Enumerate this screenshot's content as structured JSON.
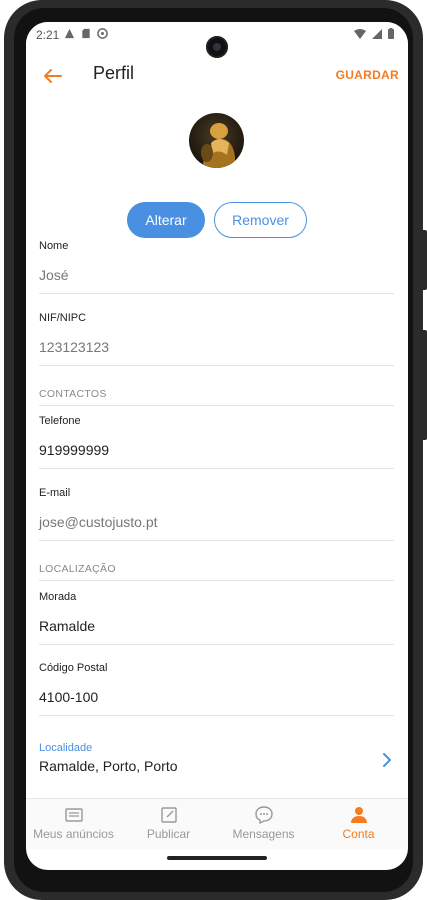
{
  "status_bar": {
    "time": "2:21"
  },
  "app_bar": {
    "title": "Perfil",
    "save_label": "GUARDAR"
  },
  "photo_actions": {
    "change_label": "Alterar",
    "remove_label": "Remover"
  },
  "fields": {
    "name": {
      "label": "Nome",
      "value": "José"
    },
    "nif": {
      "label": "NIF/NIPC",
      "value": "123123123"
    },
    "phone": {
      "label": "Telefone",
      "value": "919999999"
    },
    "email": {
      "label": "E-mail",
      "value": "jose@custojusto.pt"
    },
    "address": {
      "label": "Morada",
      "value": "Ramalde"
    },
    "postal_code": {
      "label": "Código Postal",
      "value": "4100-100"
    },
    "locality": {
      "label": "Localidade",
      "value": "Ramalde, Porto, Porto"
    }
  },
  "sections": {
    "contacts": "CONTACTOS",
    "location": "LOCALIZAÇÃO"
  },
  "bottom_nav": {
    "items": [
      {
        "label": "Meus anúncios",
        "icon": "list-icon",
        "active": false
      },
      {
        "label": "Publicar",
        "icon": "edit-icon",
        "active": false
      },
      {
        "label": "Mensagens",
        "icon": "chat-icon",
        "active": false
      },
      {
        "label": "Conta",
        "icon": "person-icon",
        "active": true
      }
    ]
  },
  "colors": {
    "accent_orange": "#f47b20",
    "accent_blue": "#4a90e2",
    "text_dark": "#222222",
    "text_muted": "#777777"
  }
}
